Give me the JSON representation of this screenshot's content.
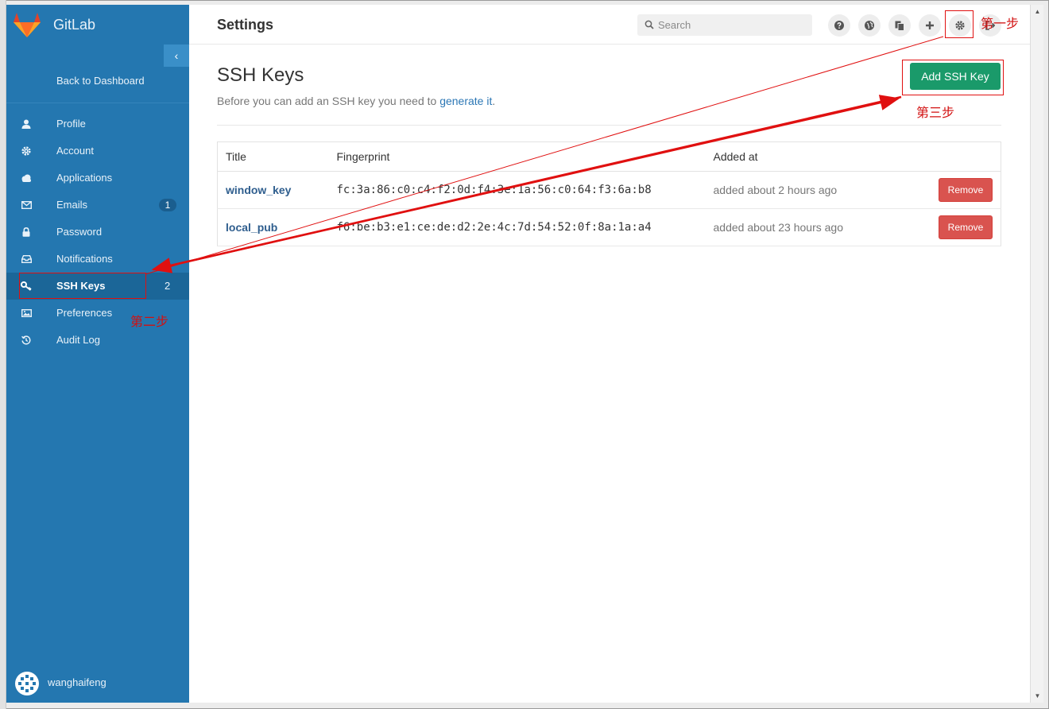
{
  "brand": {
    "name": "GitLab"
  },
  "sidebar": {
    "collapse_icon": "chevron-left-icon",
    "back_label": "Back to Dashboard",
    "items": [
      {
        "label": "Profile",
        "icon": "user-icon"
      },
      {
        "label": "Account",
        "icon": "gear-icon"
      },
      {
        "label": "Applications",
        "icon": "cloud-icon"
      },
      {
        "label": "Emails",
        "icon": "envelope-icon",
        "badge": "1"
      },
      {
        "label": "Password",
        "icon": "lock-icon"
      },
      {
        "label": "Notifications",
        "icon": "inbox-icon"
      },
      {
        "label": "SSH Keys",
        "icon": "key-icon",
        "badge": "2",
        "active": true
      },
      {
        "label": "Preferences",
        "icon": "image-icon"
      },
      {
        "label": "Audit Log",
        "icon": "history-icon"
      }
    ],
    "user": {
      "name": "wanghaifeng"
    }
  },
  "header": {
    "title": "Settings",
    "search": {
      "placeholder": "Search"
    },
    "buttons": [
      "help-icon",
      "globe-icon",
      "copy-icon",
      "plus-icon",
      "gear-icon",
      "sign-out-icon"
    ]
  },
  "main": {
    "title": "SSH Keys",
    "description_prefix": "Before you can add an SSH key you need to ",
    "description_link": "generate it",
    "description_suffix": ".",
    "add_button": "Add SSH Key",
    "table": {
      "columns": [
        "Title",
        "Fingerprint",
        "Added at",
        ""
      ],
      "rows": [
        {
          "title": "window_key",
          "fingerprint": "fc:3a:86:c0:c4:f2:0d:f4:3e:1a:56:c0:64:f3:6a:b8",
          "added": "added about 2 hours ago",
          "action": "Remove"
        },
        {
          "title": "local_pub",
          "fingerprint": "f6:be:b3:e1:ce:de:d2:2e:4c:7d:54:52:0f:8a:1a:a4",
          "added": "added about 23 hours ago",
          "action": "Remove"
        }
      ]
    }
  },
  "annotations": {
    "step1": "第一步",
    "step2": "第二步",
    "step3": "第三步",
    "color": "#e01010"
  },
  "colors": {
    "sidebar": "#2477b0",
    "sidebar_active": "#1b6698",
    "primary_button": "#1a9a6a",
    "danger_button": "#d9534f",
    "link": "#2c77b5"
  }
}
